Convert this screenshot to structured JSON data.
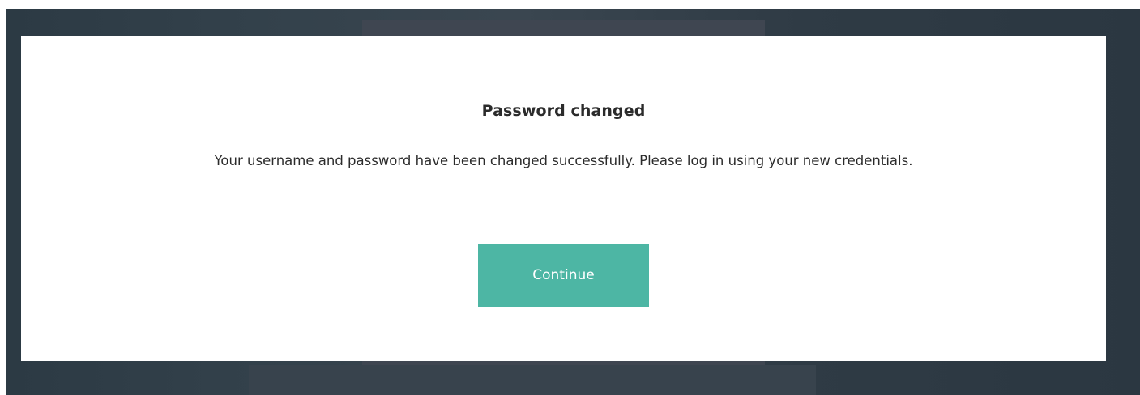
{
  "dialog": {
    "title": "Password changed",
    "message": "Your username and password have been changed successfully. Please log in using your new credentials.",
    "continue_label": "Continue"
  },
  "colors": {
    "accent": "#4db6a4",
    "backdrop": "#2f3b45",
    "modal_background": "#ffffff",
    "text": "#2b2b2b"
  }
}
